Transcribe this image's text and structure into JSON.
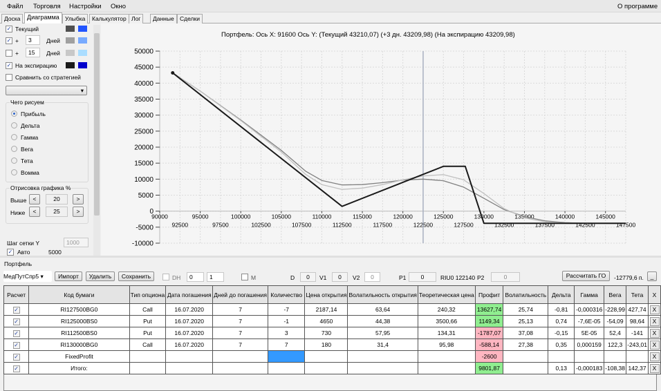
{
  "menu": {
    "items": [
      "Файл",
      "Торговля",
      "Настройки",
      "Окно"
    ],
    "about": "О программе"
  },
  "tabs": [
    "Доска",
    "Диаграмма",
    "Улыбка",
    "Калькулятор",
    "Лог",
    "Данные",
    "Сделки"
  ],
  "left": {
    "current_label": "Текущий",
    "current_checked": true,
    "plus": "+",
    "days_label": "Дней",
    "days1": "3",
    "days1_checked": true,
    "days2": "15",
    "days2_checked": false,
    "expiry_label": "На экспирацию",
    "expiry_checked": true,
    "compare_label": "Сравнить со стратегией",
    "colors": {
      "current": [
        "#505050",
        "#2255ff"
      ],
      "days1": [
        "#a0a0a0",
        "#77aaff"
      ],
      "days2": [
        "#c8c8c8",
        "#aaddff"
      ],
      "expiry": [
        "#1a1a1a",
        "#0000cc"
      ]
    },
    "draw_group": "Чего рисуем",
    "draw_options": [
      "Прибыль",
      "Дельта",
      "Гамма",
      "Вега",
      "Тета",
      "Вомма"
    ],
    "draw_selected": 0,
    "range_group": "Отрисовка графика %",
    "above_label": "Выше",
    "above_value": "20",
    "below_label": "Ниже",
    "below_value": "25",
    "less": "<",
    "more": ">",
    "grid_step_label": "Шаг сетки Y",
    "grid_step_value": "1000",
    "auto_label": "Авто",
    "auto_value": "5000"
  },
  "chart_title": "Портфель: Ось X: 91600 Ось Y:  (Текущий 43210,07)  (+3 дн. 43209,98)  (На экспирацию 43209,98)",
  "chart_data": {
    "type": "line",
    "title": "Портфель: Ось X: 91600 Ось Y:  (Текущий 43210,07)  (+3 дн. 43209,98)  (На экспирацию 43209,98)",
    "xlim": [
      90000,
      147500
    ],
    "ylim": [
      -10000,
      50000
    ],
    "xticks_top": [
      "90000",
      "95000",
      "100000",
      "105000",
      "110000",
      "115000",
      "120000",
      "125000",
      "130000",
      "135000",
      "140000",
      "145000"
    ],
    "xticks_bottom": [
      "92500",
      "97500",
      "102500",
      "107500",
      "112500",
      "117500",
      "122500",
      "127500",
      "132500",
      "137500",
      "142500",
      "147500"
    ],
    "yticks": [
      "50000",
      "45000",
      "40000",
      "35000",
      "30000",
      "25000",
      "20000",
      "15000",
      "10000",
      "5000",
      "0",
      "-5000",
      "-10000"
    ],
    "cursor_x": 122500,
    "marker": {
      "x": 91600,
      "y": 43210
    },
    "grid": true,
    "series": [
      {
        "name": "Текущий",
        "color": "#808080",
        "points": [
          [
            91600,
            43210
          ],
          [
            95000,
            37500
          ],
          [
            100000,
            28500
          ],
          [
            105000,
            19000
          ],
          [
            108000,
            12500
          ],
          [
            110000,
            9600
          ],
          [
            112500,
            8200
          ],
          [
            115000,
            8300
          ],
          [
            117500,
            8900
          ],
          [
            120000,
            9700
          ],
          [
            122500,
            10000
          ],
          [
            125000,
            9500
          ],
          [
            127500,
            7500
          ],
          [
            130000,
            4000
          ],
          [
            132500,
            500
          ],
          [
            135000,
            -1700
          ],
          [
            137500,
            -3000
          ],
          [
            140000,
            -3600
          ],
          [
            142500,
            -3800
          ],
          [
            147500,
            -3850
          ]
        ]
      },
      {
        "name": "+3 дн.",
        "color": "#c0c0c0",
        "points": [
          [
            91600,
            43210
          ],
          [
            95000,
            37500
          ],
          [
            100000,
            28300
          ],
          [
            105000,
            18500
          ],
          [
            108000,
            11500
          ],
          [
            110000,
            8300
          ],
          [
            112500,
            6800
          ],
          [
            115000,
            7200
          ],
          [
            117500,
            8300
          ],
          [
            120000,
            9800
          ],
          [
            122500,
            11000
          ],
          [
            125000,
            11400
          ],
          [
            127500,
            9800
          ],
          [
            130000,
            5500
          ],
          [
            132500,
            800
          ],
          [
            135000,
            -2100
          ],
          [
            137500,
            -3300
          ],
          [
            140000,
            -3700
          ],
          [
            147500,
            -3850
          ]
        ]
      },
      {
        "name": "На экспирацию",
        "color": "#1a1a1a",
        "points": [
          [
            91600,
            43210
          ],
          [
            112500,
            1500
          ],
          [
            125000,
            14000
          ],
          [
            127700,
            14000
          ],
          [
            130000,
            -3800
          ],
          [
            147500,
            -3800
          ]
        ]
      }
    ]
  },
  "portfolio": {
    "title": "Портфель",
    "strategy": "МедПутСпр5",
    "import": "Импорт",
    "delete": "Удалить",
    "save": "Сохранить",
    "dh_label": "DH",
    "spin1": "0",
    "spin2": "1",
    "m_label": "M",
    "d_label": "D",
    "d_value": "0",
    "v1_label": "V1",
    "v1_value": "0",
    "v2_label": "V2",
    "v2_value": "0",
    "p1_label": "P1",
    "p1_value": "0",
    "riu": "RIU0 122140",
    "p2_label": "P2",
    "p2_value": "0",
    "calc_go": "Рассчитать ГО",
    "go_value": "-12779,6 п.",
    "min_btn": "_"
  },
  "table": {
    "headers": [
      "Расчет",
      "Код бумаги",
      "Тип опциона",
      "Дата погашения",
      "Дней до погашения",
      "Количество",
      "Цена открытия",
      "Волатильность открытия",
      "Теоретическая цена",
      "Профит",
      "Волатильность",
      "Дельта",
      "Гамма",
      "Вега",
      "Тета",
      "X"
    ],
    "rows": [
      {
        "check": true,
        "code": "RI127500BG0",
        "type": "Call",
        "date": "16.07.2020",
        "days": "7",
        "qty": "-7",
        "price": "2187,14",
        "vol_open": "63,64",
        "theo": "240,32",
        "profit": "13627,74",
        "profit_sign": "pos",
        "vol": "25,74",
        "delta": "-0,81",
        "gamma": "-0,000316",
        "vega": "-228,99",
        "theta": "427,74"
      },
      {
        "check": true,
        "code": "RI125000BS0",
        "type": "Put",
        "date": "16.07.2020",
        "days": "7",
        "qty": "-1",
        "price": "4650",
        "vol_open": "44,38",
        "theo": "3500,66",
        "profit": "1149,34",
        "profit_sign": "pos",
        "vol": "25,13",
        "delta": "0,74",
        "gamma": "-7,6E-05",
        "vega": "-54,09",
        "theta": "98,64"
      },
      {
        "check": true,
        "code": "RI112500BS0",
        "type": "Put",
        "date": "16.07.2020",
        "days": "7",
        "qty": "3",
        "price": "730",
        "vol_open": "57,95",
        "theo": "134,31",
        "profit": "-1787,07",
        "profit_sign": "neg",
        "vol": "37,08",
        "delta": "-0,15",
        "gamma": "5E-05",
        "vega": "52,4",
        "theta": "-141"
      },
      {
        "check": true,
        "code": "RI130000BG0",
        "type": "Call",
        "date": "16.07.2020",
        "days": "7",
        "qty": "7",
        "price": "180",
        "vol_open": "31,4",
        "theo": "95,98",
        "profit": "-588,14",
        "profit_sign": "neg",
        "vol": "27,38",
        "delta": "0,35",
        "gamma": "0,000159",
        "vega": "122,3",
        "theta": "-243,01"
      },
      {
        "check": true,
        "code": "FixedProfit",
        "type": "",
        "date": "",
        "days": "",
        "qty": "",
        "qty_selected": true,
        "price": "",
        "vol_open": "",
        "theo": "",
        "profit": "-2600",
        "profit_sign": "neg",
        "vol": "",
        "delta": "",
        "gamma": "",
        "vega": "",
        "theta": ""
      },
      {
        "check": true,
        "code": "Итого:",
        "type": "",
        "date": "",
        "days": "",
        "qty": "",
        "price": "",
        "vol_open": "",
        "theo": "",
        "profit": "9801,87",
        "profit_sign": "pos",
        "vol": "",
        "delta": "0,13",
        "gamma": "-0,000183",
        "vega": "-108,38",
        "theta": "142,37"
      }
    ],
    "delete_label": "X"
  }
}
